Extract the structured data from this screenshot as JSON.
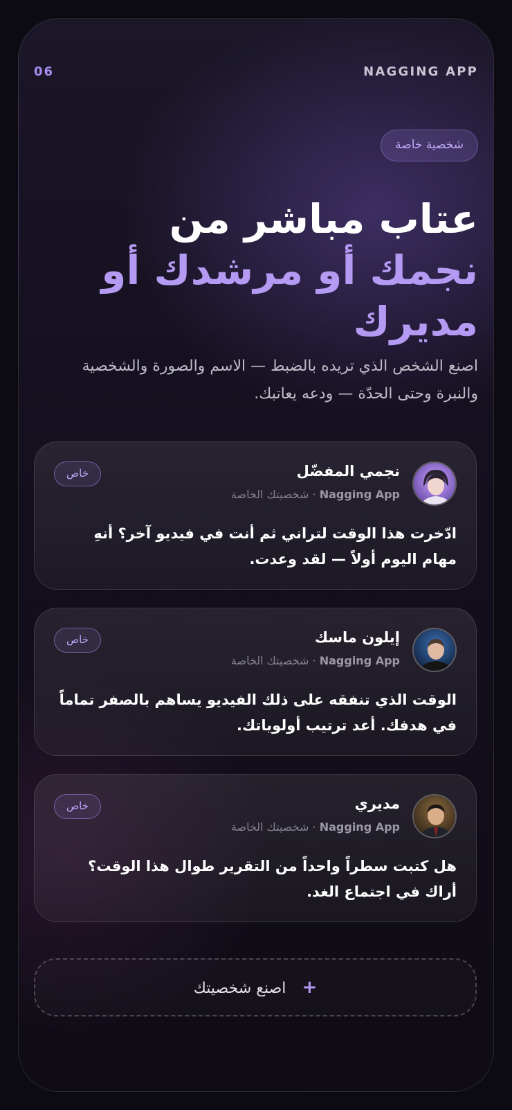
{
  "header": {
    "number": "06",
    "app_name": "NAGGING APP"
  },
  "tag": "شخصية خاصة",
  "headline": {
    "white": "عتاب مباشر من",
    "accent": "نجمك أو مرشدك أو مديرك"
  },
  "subtitle": "اصنع الشخص الذي تريده بالضبط — الاسم والصورة والشخصية والنبرة وحتى الحدّة — ودعه يعاتبك.",
  "cards": [
    {
      "name": "نجمي المفضّل",
      "app": "Nagging App",
      "separator": "·",
      "sub": "شخصيتك الخاصة",
      "pill": "خاص",
      "message": "ادّخرت هذا الوقت لتراني ثم أنت في فيديو آخر؟ أنهِ مهام اليوم أولاً — لقد وعدت.",
      "avatar_icon": "star-avatar"
    },
    {
      "name": "إيلون ماسك",
      "app": "Nagging App",
      "separator": "·",
      "sub": "شخصيتك الخاصة",
      "pill": "خاص",
      "message": "الوقت الذي تنفقه على ذلك الفيديو يساهم بالصفر تماماً في هدفك. أعد ترتيب أولوياتك.",
      "avatar_icon": "mentor-avatar"
    },
    {
      "name": "مديري",
      "app": "Nagging App",
      "separator": "·",
      "sub": "شخصيتك الخاصة",
      "pill": "خاص",
      "message": "هل كتبت سطراً واحداً من التقرير طوال هذا الوقت؟ أراك في اجتماع الغد.",
      "avatar_icon": "boss-avatar"
    }
  ],
  "create_button": {
    "icon": "+",
    "label": "اصنع شخصيتك"
  },
  "colors": {
    "accent": "#b59af3",
    "background": "#0d0b12"
  }
}
